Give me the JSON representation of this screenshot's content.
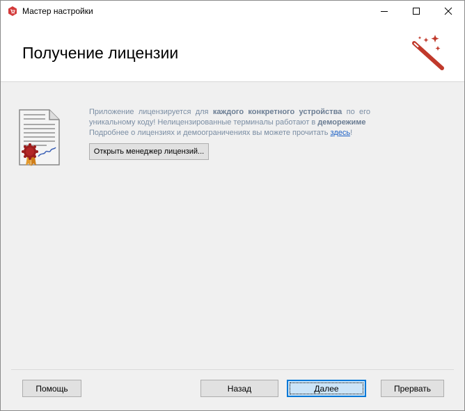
{
  "window": {
    "title": "Мастер настройки"
  },
  "header": {
    "title": "Получение лицензии"
  },
  "info": {
    "line1_pre": "Приложение лицензируется для",
    "line1_bold": "каждого конкретного устройства",
    "line1_post": "по его",
    "line2_pre": "уникальному коду! Нелицензированные терминалы работают в",
    "line2_bold": "деморежиме",
    "line3_pre": "Подробнее о лицензиях и демоограничениях вы можете прочитать",
    "line3_link": "здесь",
    "line3_post": "!"
  },
  "license_manager_button": "Открыть менеджер лицензий...",
  "footer": {
    "help": "Помощь",
    "back": "Назад",
    "next": "Далее",
    "cancel": "Прервать"
  },
  "colors": {
    "accent": "#c0392b",
    "info_text": "#7a8da3",
    "link": "#1a5fc4",
    "primary_button_border": "#0078d7"
  },
  "icons": [
    "app-icon",
    "minimize-icon",
    "maximize-icon",
    "close-icon",
    "magic-wand-icon",
    "license-document-icon"
  ]
}
